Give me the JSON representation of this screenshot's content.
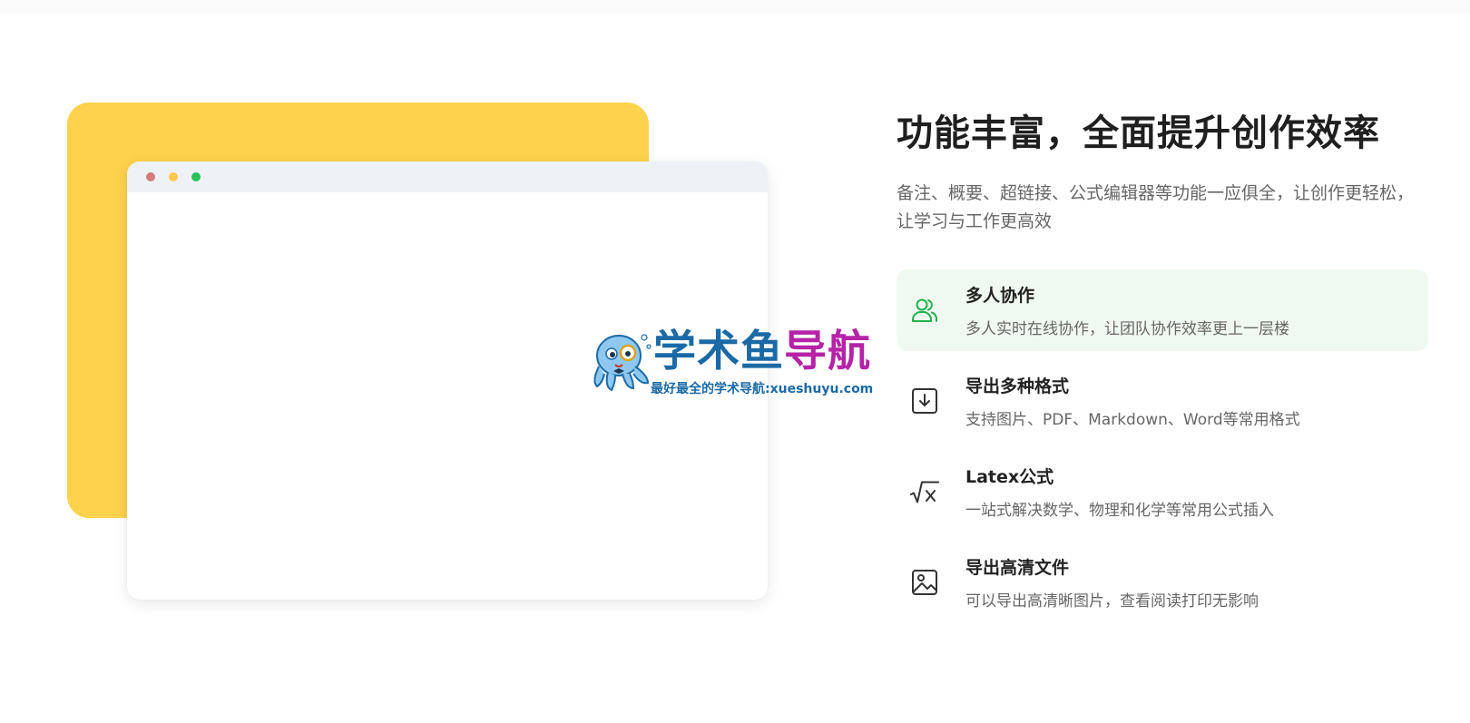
{
  "browser_mock": {
    "dots": [
      "#d67b7c",
      "#fec84c",
      "#27c159"
    ]
  },
  "watermark": {
    "title_part1": "学术鱼",
    "title_part2": "导航",
    "subtitle": "最好最全的学术导航:xueshuyu.com",
    "colors": {
      "blue": "#1b6aa6",
      "magenta": "#b523a6"
    }
  },
  "section": {
    "heading": "功能丰富，全面提升创作效率",
    "intro": "备注、概要、超链接、公式编辑器等功能一应俱全，让创作更轻松，让学习与工作更高效"
  },
  "features": [
    {
      "icon": "users-icon",
      "title": "多人协作",
      "desc": "多人实时在线协作，让团队协作效率更上一层楼",
      "active": true
    },
    {
      "icon": "download-icon",
      "title": "导出多种格式",
      "desc": "支持图片、PDF、Markdown、Word等常用格式",
      "active": false
    },
    {
      "icon": "formula-icon",
      "title": "Latex公式",
      "desc": "一站式解决数学、物理和化学等常用公式插入",
      "active": false
    },
    {
      "icon": "image-icon",
      "title": "导出高清文件",
      "desc": "可以导出高清晰图片，查看阅读打印无影响",
      "active": false
    }
  ],
  "colors": {
    "accent_green": "#22b24c",
    "yellow": "#fed24c"
  }
}
